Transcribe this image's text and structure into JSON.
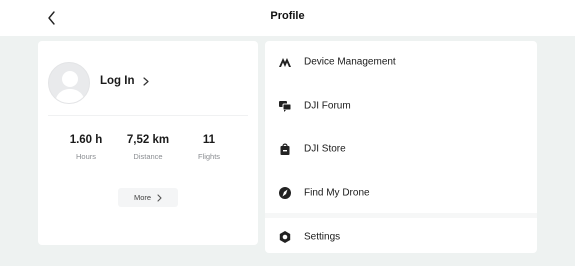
{
  "header": {
    "title": "Profile"
  },
  "account": {
    "login_label": "Log In",
    "stats": [
      {
        "value": "1.60 h",
        "label": "Hours"
      },
      {
        "value": "7,52 km",
        "label": "Distance"
      },
      {
        "value": "11",
        "label": "Flights"
      }
    ],
    "more_label": "More"
  },
  "menu": [
    {
      "label": "Device Management",
      "icon": "dji-logo-icon"
    },
    {
      "label": "DJI Forum",
      "icon": "forum-icon"
    },
    {
      "label": "DJI Store",
      "icon": "store-bag-icon"
    },
    {
      "label": "Find My Drone",
      "icon": "find-drone-icon"
    },
    {
      "label": "Settings",
      "icon": "settings-gear-icon"
    }
  ],
  "colors": {
    "background": "#eef2f1",
    "card": "#ffffff",
    "text": "#1a1a1a",
    "secondary_text": "#8a8d91"
  }
}
